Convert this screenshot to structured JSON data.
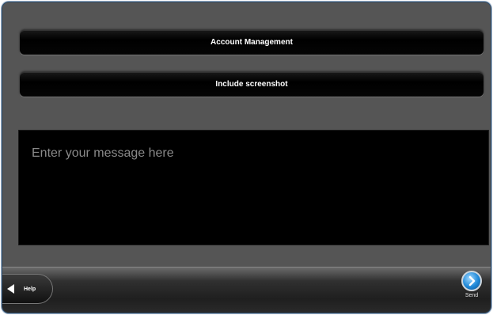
{
  "buttons": {
    "account_management": "Account Management",
    "include_screenshot": "Include screenshot"
  },
  "message": {
    "placeholder": "Enter your message here"
  },
  "footer": {
    "help_label": "Help",
    "send_label": "Send"
  },
  "icons": {
    "help": "back-arrow-icon",
    "send": "forward-arrow-icon"
  },
  "colors": {
    "send_accent": "#1e88d8",
    "background": "#555555"
  }
}
